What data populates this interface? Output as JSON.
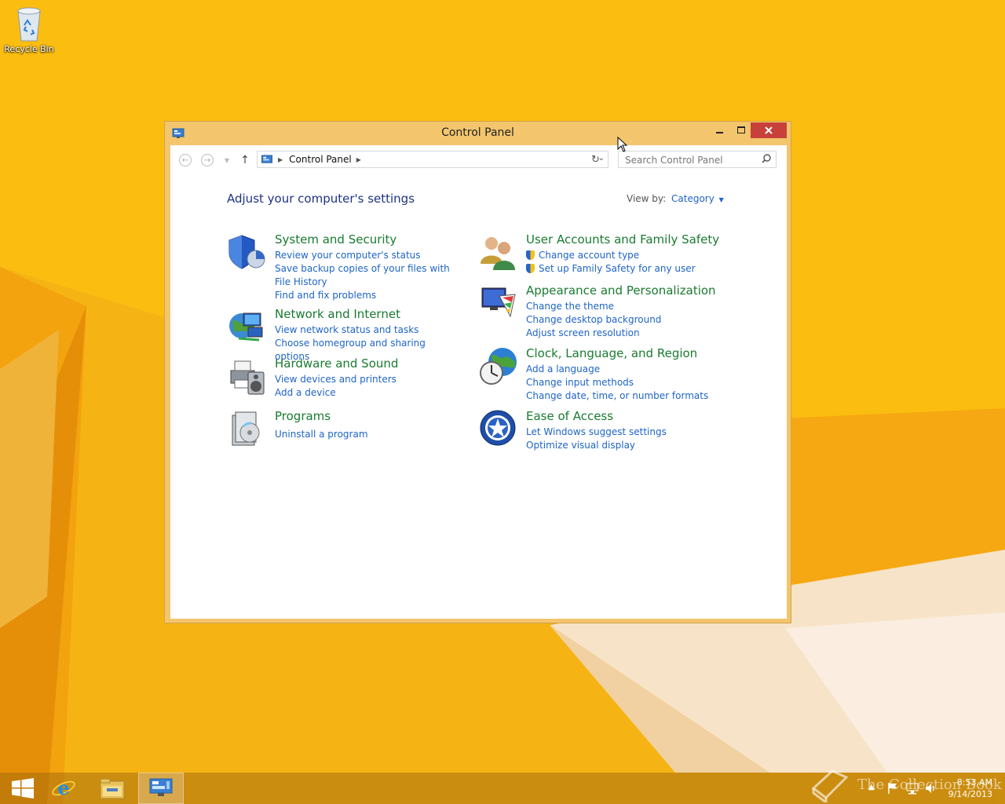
{
  "desktop": {
    "recycle_bin_label": "Recycle Bin"
  },
  "window": {
    "title": "Control Panel",
    "address": {
      "crumb": "Control Panel"
    },
    "search": {
      "placeholder": "Search Control Panel"
    },
    "heading": "Adjust your computer's settings",
    "view_by_label": "View by:",
    "view_by_value": "Category",
    "categories_left": [
      {
        "title": "System and Security",
        "icon": "shield-icon",
        "links": [
          "Review your computer's status",
          "Save backup copies of your files with File History",
          "Find and fix problems"
        ]
      },
      {
        "title": "Network and Internet",
        "icon": "network-globe-icon",
        "links": [
          "View network status and tasks",
          "Choose homegroup and sharing options"
        ]
      },
      {
        "title": "Hardware and Sound",
        "icon": "printer-speaker-icon",
        "links": [
          "View devices and printers",
          "Add a device"
        ]
      },
      {
        "title": "Programs",
        "icon": "programs-icon",
        "links": [
          "Uninstall a program"
        ]
      }
    ],
    "categories_right": [
      {
        "title": "User Accounts and Family Safety",
        "icon": "users-icon",
        "links": [
          "Change account type",
          "Set up Family Safety for any user"
        ]
      },
      {
        "title": "Appearance and Personalization",
        "icon": "monitor-palette-icon",
        "links": [
          "Change the theme",
          "Change desktop background",
          "Adjust screen resolution"
        ]
      },
      {
        "title": "Clock, Language, and Region",
        "icon": "clock-globe-icon",
        "links": [
          "Add a language",
          "Change input methods",
          "Change date, time, or number formats"
        ]
      },
      {
        "title": "Ease of Access",
        "icon": "ease-of-access-icon",
        "links": [
          "Let Windows suggest settings",
          "Optimize visual display"
        ]
      }
    ]
  },
  "taskbar": {
    "time": "8:53 AM",
    "date": "9/14/2013",
    "watermark": "The Collection Book"
  },
  "colors": {
    "category_title": "#197b30",
    "link": "#1e64c8",
    "close_button": "#c7413a",
    "window_frame": "#f3c56d"
  }
}
